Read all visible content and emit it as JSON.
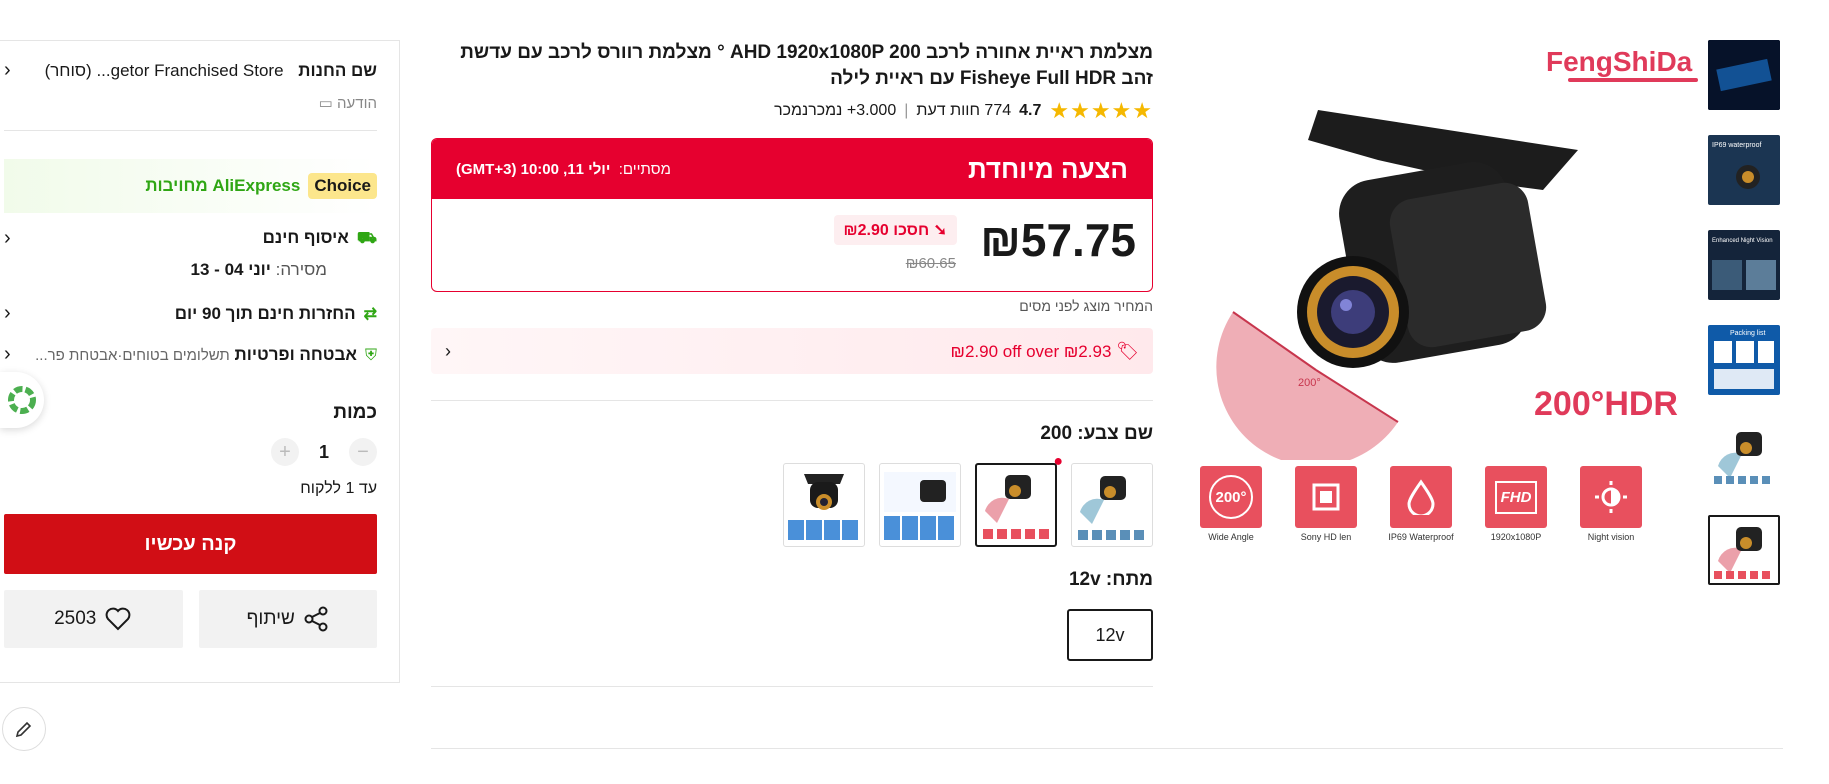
{
  "product": {
    "title": "מצלמת ראיית אחורה לרכב AHD 1920x1080P 200 ° מצלמת רוורס לרכב עם עדשת זהב Fisheye Full HDR עם ראיית לילה",
    "rating": "4.7",
    "reviews": "774 חוות דעת",
    "sold": "3.000+ נמכרנמכר"
  },
  "image": {
    "brand": "FengShiDa",
    "hdr_label": "200°HDR",
    "angle_label": "200°",
    "features": [
      {
        "icon": "200°",
        "label": "Wide Angle"
      },
      {
        "icon": "chip",
        "label": "Sony HD len"
      },
      {
        "icon": "drop",
        "label": "IP69 Waterproof"
      },
      {
        "icon": "FHD",
        "label": "1920x1080P"
      },
      {
        "icon": "sun",
        "label": "Night vision"
      }
    ],
    "thumb_texts": [
      "",
      "IP69 waterproof",
      "Enhanced Night Vision",
      "Packing list",
      "",
      ""
    ]
  },
  "offer": {
    "title": "הצעה מיוחדת",
    "ends_label": "מסתיים:",
    "ends_value": "יולי 11, 10:00 (GMT+3)",
    "price": "₪57.75",
    "save": "חסכו ₪2.90",
    "original": "₪60.65",
    "tax_note": "המחיר מוצג לפני מסים",
    "coupon": "₪2.90 off over ₪2.93"
  },
  "options": {
    "color_label": "שם צבע: 200",
    "size_label": "מתח: 12v",
    "size_value": "12v"
  },
  "sidebar": {
    "store_label": "שם החנות",
    "store_name": "getor Franchised Store... (סוחר)",
    "message": "הודעה",
    "choice": "Choice",
    "ali_commit": "AliExpress מחויבות",
    "shipping": "איסוף חינם",
    "delivery_label": "מסירה:",
    "delivery_value": "יוני 04 - 13",
    "returns": "החזרות חינם תוך 90 יום",
    "security_title": "אבטחה ופרטיות",
    "security_detail": "תשלומים בטוחים·אבטחת פר...",
    "quantity_label": "כמות",
    "quantity": "1",
    "limit": "עד 1 ללקוח",
    "buy": "קנה עכשיו",
    "share": "שיתוף",
    "wishlist": "2503"
  },
  "colors": {
    "accent": "#e6002f",
    "buy": "#d10e15",
    "choice": "#fce68c",
    "green": "#2fa614",
    "brand": "#e03a5a"
  }
}
